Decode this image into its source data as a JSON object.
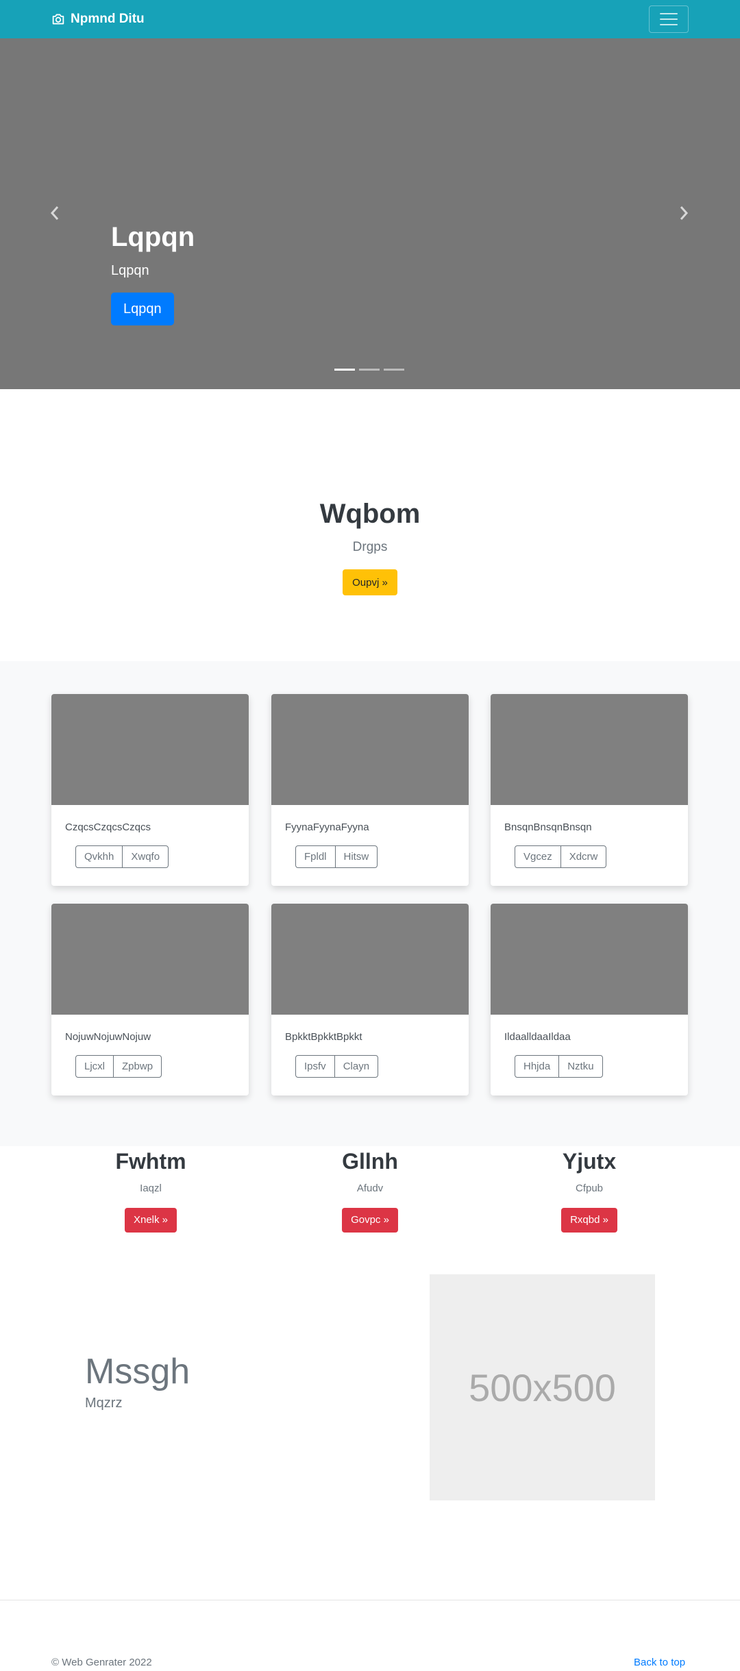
{
  "navbar": {
    "brand": "Npmnd Ditu",
    "bg_color": "#17a2b8",
    "brand_icon": "camera-icon",
    "menu_icon": "hamburger-icon"
  },
  "carousel": {
    "heading": "Lqpqn",
    "text": "Lqpqn",
    "button": "Lqpqn",
    "prev_icon": "chevron-left-icon",
    "next_icon": "chevron-right-icon"
  },
  "jumbotron": {
    "title": "Wqbom",
    "subtitle": "Drgps",
    "button": "Oupvj »"
  },
  "cards": [
    {
      "text": "CzqcsCzqcsCzqcs",
      "btn1": "Qvkhh",
      "btn2": "Xwqfo"
    },
    {
      "text": "FyynaFyynaFyyna",
      "btn1": "Fpldl",
      "btn2": "Hitsw"
    },
    {
      "text": "BnsqnBnsqnBnsqn",
      "btn1": "Vgcez",
      "btn2": "Xdcrw"
    },
    {
      "text": "NojuwNojuwNojuw",
      "btn1": "Ljcxl",
      "btn2": "Zpbwp"
    },
    {
      "text": "BpkktBpkktBpkkt",
      "btn1": "Ipsfv",
      "btn2": "Clayn"
    },
    {
      "text": "IldaalldaaIldaa",
      "btn1": "Hhjda",
      "btn2": "Nztku"
    }
  ],
  "features": [
    {
      "title": "Fwhtm",
      "text": "Iaqzl",
      "button": "Xnelk »"
    },
    {
      "title": "Gllnh",
      "text": "Afudv",
      "button": "Govpc »"
    },
    {
      "title": "Yjutx",
      "text": "Cfpub",
      "button": "Rxqbd »"
    }
  ],
  "featurette": {
    "heading": "Mssgh",
    "text": "Mqzrz",
    "image_label": "500x500"
  },
  "footer": {
    "copyright": "© Web Genrater 2022",
    "back_to_top": "Back to top"
  }
}
